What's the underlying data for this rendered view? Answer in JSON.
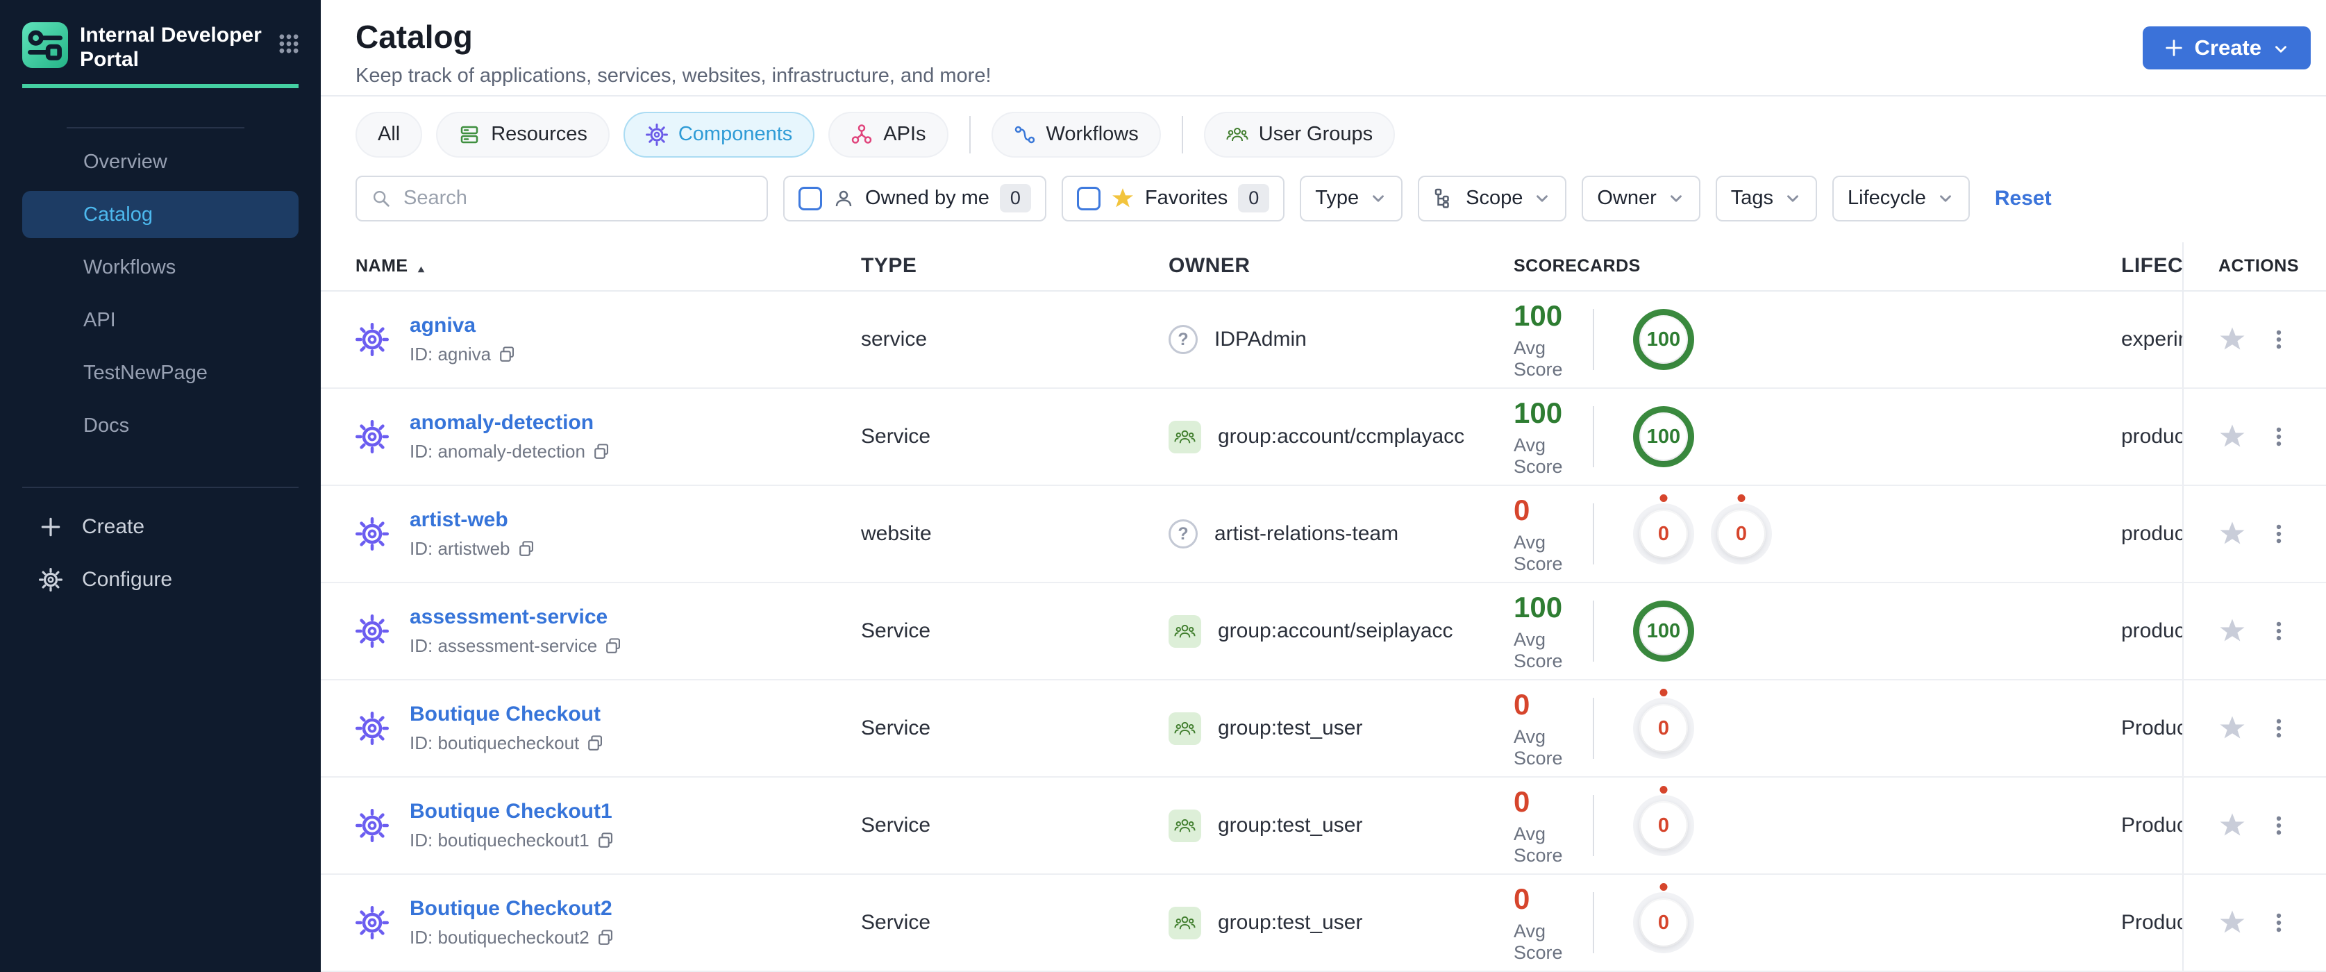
{
  "brand": {
    "title": "Internal Developer Portal"
  },
  "sidebar": {
    "items": [
      {
        "label": "Overview",
        "active": false
      },
      {
        "label": "Catalog",
        "active": true
      },
      {
        "label": "Workflows",
        "active": false
      },
      {
        "label": "API",
        "active": false
      },
      {
        "label": "TestNewPage",
        "active": false
      },
      {
        "label": "Docs",
        "active": false
      }
    ],
    "footer": [
      {
        "label": "Create",
        "icon": "plus-icon"
      },
      {
        "label": "Configure",
        "icon": "gear-icon"
      }
    ]
  },
  "header": {
    "title": "Catalog",
    "subtitle": "Keep track of applications, services, websites, infrastructure, and more!",
    "create_label": "Create"
  },
  "tabs": [
    {
      "label": "All"
    },
    {
      "label": "Resources",
      "icon": "resources-icon"
    },
    {
      "label": "Components",
      "icon": "components-gear-icon",
      "active": true
    },
    {
      "label": "APIs",
      "icon": "apis-icon"
    },
    {
      "label": "Workflows",
      "icon": "workflows-icon"
    },
    {
      "label": "User Groups",
      "icon": "user-groups-icon"
    }
  ],
  "filters": {
    "search_placeholder": "Search",
    "owned_by_me": {
      "label": "Owned by me",
      "count": "0"
    },
    "favorites": {
      "label": "Favorites",
      "count": "0"
    },
    "dropdowns": [
      {
        "label": "Type"
      },
      {
        "label": "Scope",
        "icon": "hierarchy-icon"
      },
      {
        "label": "Owner"
      },
      {
        "label": "Tags"
      },
      {
        "label": "Lifecycle"
      }
    ],
    "reset_label": "Reset"
  },
  "table": {
    "columns": [
      "NAME",
      "TYPE",
      "OWNER",
      "SCORECARDS",
      "LIFECYCLE",
      "ACTIONS"
    ],
    "avg_label": "Avg Score",
    "rows": [
      {
        "name": "agniva",
        "id": "ID: agniva",
        "type": "service",
        "owner": {
          "label": "IDPAdmin",
          "icon": "question"
        },
        "avg_score": {
          "value": "100",
          "status": "pass"
        },
        "scorecards": [
          {
            "value": "100",
            "status": "pass"
          }
        ],
        "lifecycle": "experimental"
      },
      {
        "name": "anomaly-detection",
        "id": "ID: anomaly-detection",
        "type": "Service",
        "owner": {
          "label": "group:account/ccmplayacc",
          "icon": "group"
        },
        "avg_score": {
          "value": "100",
          "status": "pass"
        },
        "scorecards": [
          {
            "value": "100",
            "status": "pass"
          }
        ],
        "lifecycle": "production"
      },
      {
        "name": "artist-web",
        "id": "ID: artistweb",
        "type": "website",
        "owner": {
          "label": "artist-relations-team",
          "icon": "question"
        },
        "avg_score": {
          "value": "0",
          "status": "fail"
        },
        "scorecards": [
          {
            "value": "0",
            "status": "fail"
          },
          {
            "value": "0",
            "status": "fail"
          }
        ],
        "lifecycle": "production"
      },
      {
        "name": "assessment-service",
        "id": "ID: assessment-service",
        "type": "Service",
        "owner": {
          "label": "group:account/seiplayacc",
          "icon": "group"
        },
        "avg_score": {
          "value": "100",
          "status": "pass"
        },
        "scorecards": [
          {
            "value": "100",
            "status": "pass"
          }
        ],
        "lifecycle": "production"
      },
      {
        "name": "Boutique Checkout",
        "id": "ID: boutiquecheckout",
        "type": "Service",
        "owner": {
          "label": "group:test_user",
          "icon": "group"
        },
        "avg_score": {
          "value": "0",
          "status": "fail"
        },
        "scorecards": [
          {
            "value": "0",
            "status": "fail"
          }
        ],
        "lifecycle": "Production"
      },
      {
        "name": "Boutique Checkout1",
        "id": "ID: boutiquecheckout1",
        "type": "Service",
        "owner": {
          "label": "group:test_user",
          "icon": "group"
        },
        "avg_score": {
          "value": "0",
          "status": "fail"
        },
        "scorecards": [
          {
            "value": "0",
            "status": "fail"
          }
        ],
        "lifecycle": "Production"
      },
      {
        "name": "Boutique Checkout2",
        "id": "ID: boutiquecheckout2",
        "type": "Service",
        "owner": {
          "label": "group:test_user",
          "icon": "group"
        },
        "avg_score": {
          "value": "0",
          "status": "fail"
        },
        "scorecards": [
          {
            "value": "0",
            "status": "fail"
          }
        ],
        "lifecycle": "Production"
      }
    ]
  },
  "colors": {
    "accent_teal": "#44d0a2",
    "sidebar_bg": "#0f1b2d",
    "active_nav_bg": "#1d3c64",
    "active_nav_text": "#4db9ee",
    "primary_blue": "#3b72d9",
    "link_blue": "#3674d9",
    "active_tab_bg": "#e7f6fd",
    "active_tab_text": "#2e9bd6",
    "success_green": "#2e7d32",
    "danger_red": "#d6452c",
    "star_yellow": "#f2c43d"
  }
}
